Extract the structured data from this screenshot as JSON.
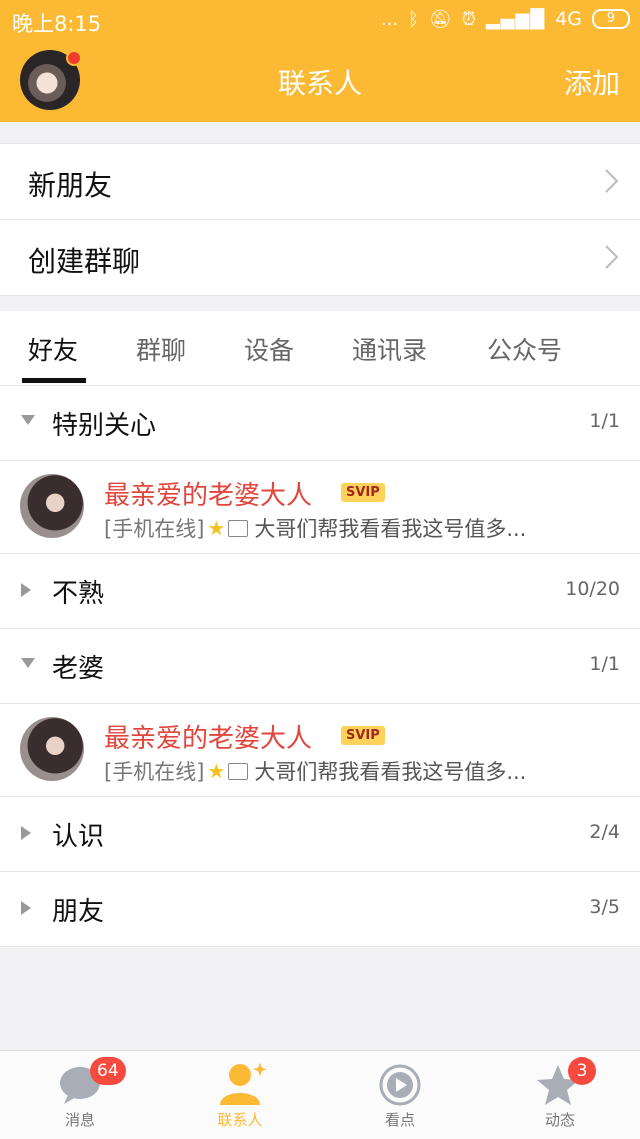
{
  "status": {
    "time": "晚上8:15",
    "dots": "...",
    "network": "4G",
    "battery": "9"
  },
  "header": {
    "title": "联系人",
    "add_label": "添加"
  },
  "actions": [
    {
      "label": "新朋友"
    },
    {
      "label": "创建群聊"
    }
  ],
  "tabs": [
    "好友",
    "群聊",
    "设备",
    "通讯录",
    "公众号"
  ],
  "groups": {
    "special": {
      "name": "特别关心",
      "count": "1/1"
    },
    "unfamiliar": {
      "name": "不熟",
      "count": "10/20"
    },
    "wife": {
      "name": "老婆",
      "count": "1/1"
    },
    "acquaint": {
      "name": "认识",
      "count": "2/4"
    },
    "friends": {
      "name": "朋友",
      "count": "3/5"
    }
  },
  "contacts": {
    "c1": {
      "name": "最亲爱的老婆大人",
      "badge": "SVIP",
      "status": "[手机在线]",
      "message": "大哥们帮我看看我这号值多..."
    },
    "c2": {
      "name": "最亲爱的老婆大人",
      "badge": "SVIP",
      "status": "[手机在线]",
      "message": "大哥们帮我看看我这号值多..."
    }
  },
  "bottom_nav": [
    {
      "label": "消息",
      "badge": "64"
    },
    {
      "label": "联系人"
    },
    {
      "label": "看点"
    },
    {
      "label": "动态",
      "badge": "3"
    }
  ],
  "colors": {
    "accent": "#fbb934",
    "badge_red": "#f54a3d",
    "name_red": "#e2453c"
  }
}
